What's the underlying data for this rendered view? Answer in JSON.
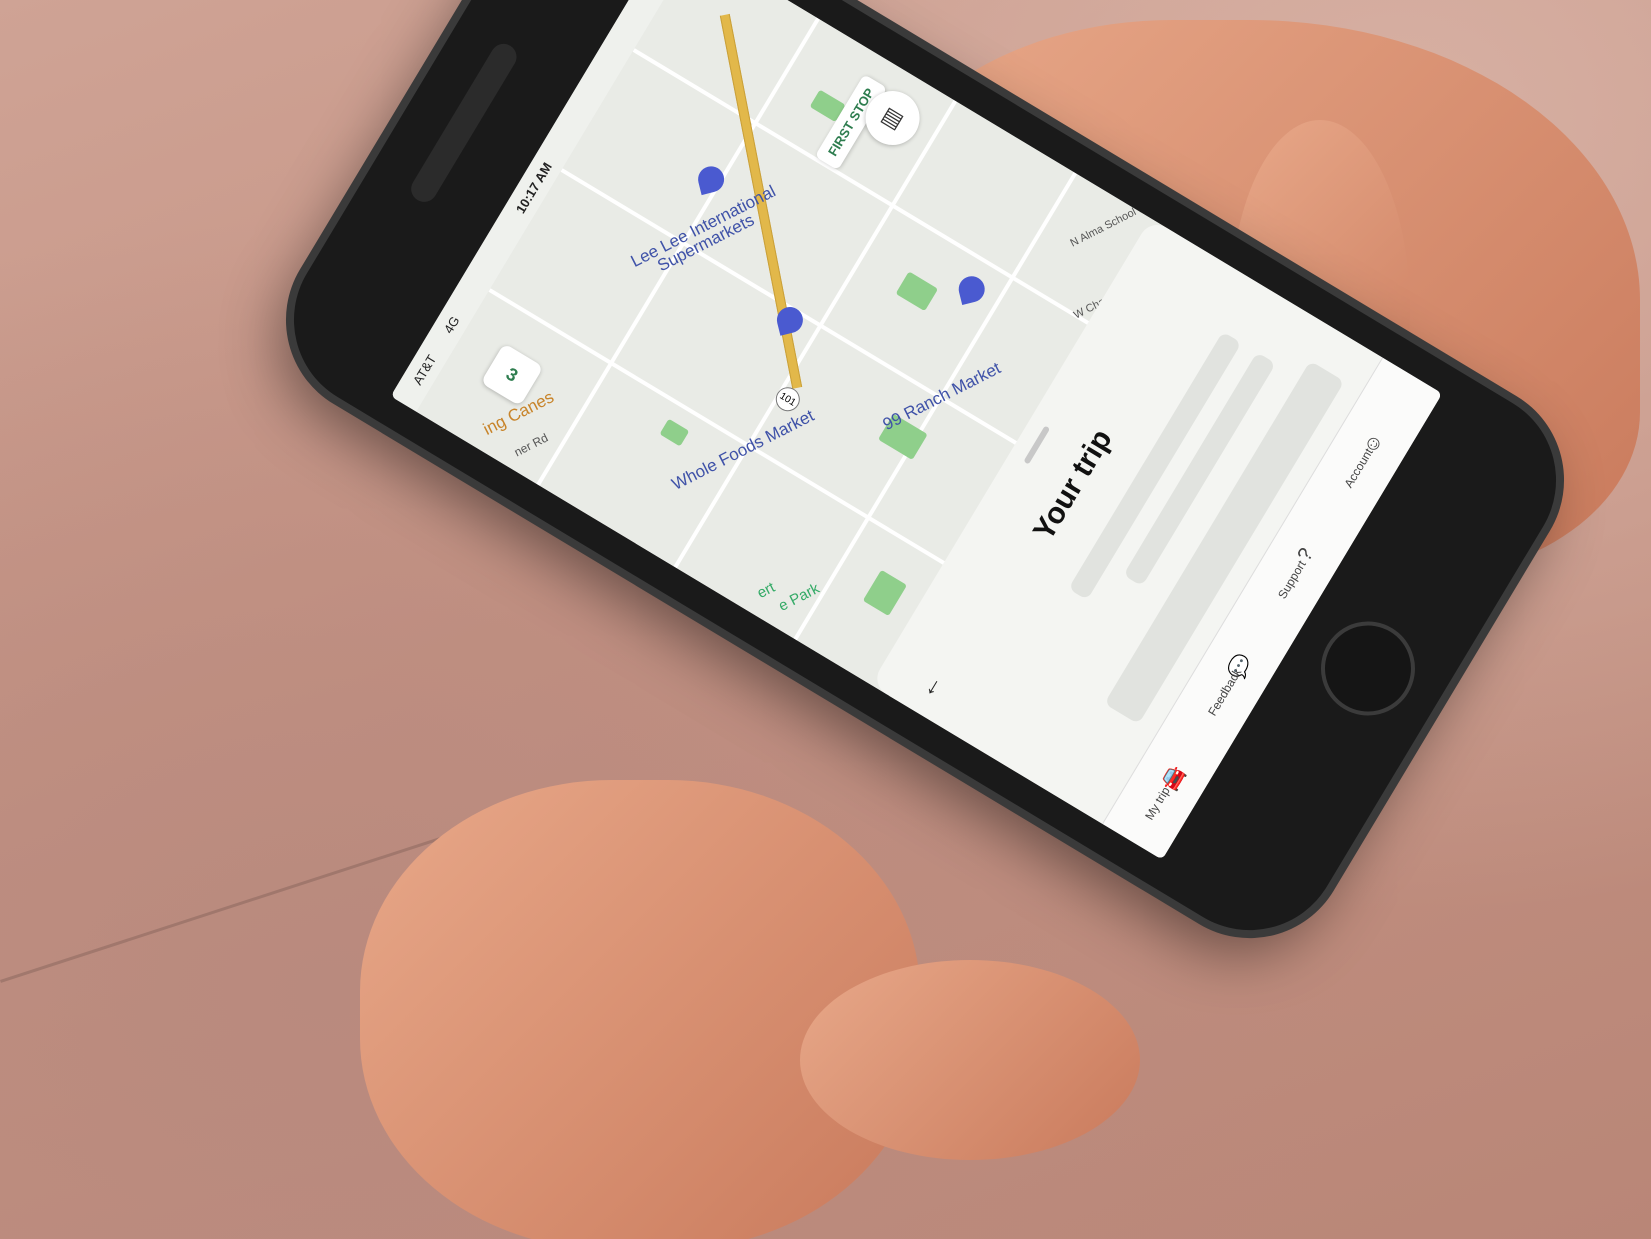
{
  "status_bar": {
    "carrier": "AT&T",
    "network": "4G",
    "time": "10:17 AM"
  },
  "map": {
    "labels": [
      "Lee Lee International",
      "Supermarkets",
      "Whole Foods Market",
      "99 Ranch Market",
      "ing Canes",
      "ner Rd",
      "N Alma School Rd",
      "W Chandler Blvd",
      "ert",
      "e Park"
    ],
    "first_stop_tag": "FIRST STOP",
    "stop_count_badge": "3",
    "route_shield": "101",
    "layers_icon": "layers-icon"
  },
  "sheet": {
    "title": "Your trip",
    "back_icon": "back-arrow-icon"
  },
  "tabs": [
    {
      "label": "My trip",
      "icon": "car-icon"
    },
    {
      "label": "Feedback",
      "icon": "feedback-icon"
    },
    {
      "label": "Support",
      "icon": "help-icon"
    },
    {
      "label": "Account",
      "icon": "account-icon"
    }
  ],
  "colors": {
    "pin": "#4a5ad0",
    "stop_green": "#2e7d4f",
    "highway": "#e2b84a",
    "park": "#8fcf8b"
  }
}
